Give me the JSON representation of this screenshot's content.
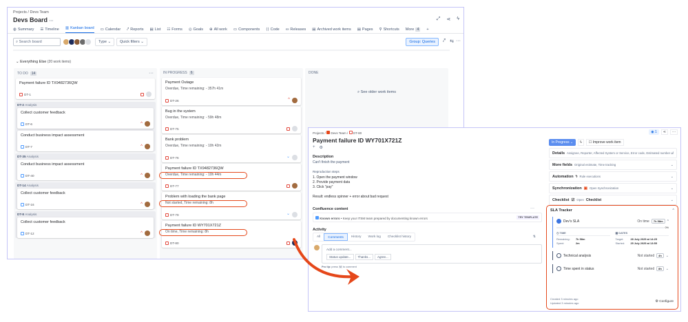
{
  "board": {
    "breadcrumb": [
      "Projects",
      "/",
      "Devs Team"
    ],
    "title": "Devs Board",
    "tabs": [
      "Summary",
      "Timeline",
      "Kanban board",
      "Calendar",
      "Reports",
      "List",
      "Forms",
      "Goals",
      "All work",
      "Components",
      "Code",
      "Releases",
      "Archived work items",
      "Pages",
      "Shortcuts"
    ],
    "active_tab": 2,
    "more_label": "More",
    "more_count": "4",
    "search_placeholder": "Search board",
    "type_label": "Type",
    "quick_filters_label": "Quick filters",
    "group_label": "Group: Queries",
    "swimlane": {
      "label": "Everything Else",
      "count": "(20 work items)"
    },
    "columns": {
      "todo": {
        "title": "TO DO",
        "count": "14"
      },
      "inprogress": {
        "title": "IN PROGRESS",
        "count": "6"
      },
      "done": {
        "title": "DONE",
        "see_older": "See older work items"
      }
    },
    "todo_items": [
      {
        "title": "Payment failure ID TX9482736QW",
        "key": "DT-1",
        "type": "bug",
        "assignee": "none"
      },
      {
        "group": "DT-2",
        "group_label": "Analysis",
        "items": [
          {
            "title": "Collect customer feedback",
            "key": "DT-6",
            "type": "subtask",
            "assignee": "user"
          },
          {
            "title": "Conduct business impact assessment",
            "key": "DT-7",
            "type": "subtask",
            "assignee": "user"
          }
        ]
      },
      {
        "group": "DT-35",
        "group_label": "Analysis",
        "items": [
          {
            "title": "Conduct business impact assessment",
            "key": "DT-40",
            "type": "subtask",
            "assignee": "user"
          }
        ]
      },
      {
        "group": "DT-14",
        "group_label": "Analysis",
        "items": [
          {
            "title": "Collect customer feedback",
            "key": "DT-16",
            "type": "subtask",
            "assignee": "user"
          }
        ]
      },
      {
        "group": "DT-8",
        "group_label": "Analysis",
        "items": [
          {
            "title": "Collect customer feedback",
            "key": "DT-12",
            "type": "subtask",
            "assignee": "user"
          }
        ]
      }
    ],
    "inprogress_items": [
      {
        "title": "Payment Outage",
        "status": "Overdue, Time remaining: - 357h 41m",
        "key": "DT-26",
        "priority": "high",
        "highlighted": false
      },
      {
        "title": "Bug in the system",
        "status": "Overdue, Time remaining: - 59h 48m",
        "key": "DT-75",
        "priority": "bug",
        "highlighted": false
      },
      {
        "title": "Bank problem",
        "status": "Overdue, Time remaining: - 10h 42m",
        "key": "DT-76",
        "priority": "low",
        "highlighted": false
      },
      {
        "title": "Payment failure ID TX9482736QW",
        "status": "Overdue, Time remaining: - 10h 44m",
        "key": "DT-77",
        "priority": "bug",
        "highlighted": true
      },
      {
        "title": "Problem with loading the bank page",
        "status": "Not started, Time remaining: 8h",
        "key": "DT-79",
        "priority": "low",
        "highlighted": true
      },
      {
        "title": "Payment failure ID WY701X721Z",
        "status": "On time, Time remaining: 8h",
        "key": "DT-80",
        "priority": "bug",
        "highlighted": true
      }
    ]
  },
  "detail": {
    "breadcrumb": [
      "Projects",
      "/",
      "Devs Team",
      "/",
      "DT-80"
    ],
    "title": "Payment failure ID WY701X721Z",
    "description_heading": "Description",
    "description": "Can't finish the payment",
    "repro_heading": "Reproduction steps",
    "steps": [
      "1. Open the payment window",
      "2. Provide payment data",
      "3. Click \"pay\""
    ],
    "result": "Result: endless spinner + error about bad request",
    "confluence": {
      "heading": "Confluence content",
      "item": "Known errors",
      "text": "• Keep your ITSM team prepared by documenting known errors",
      "button": "TRY TEMPLATE"
    },
    "activity": {
      "heading": "Activity",
      "tabs": [
        "All",
        "Comments",
        "History",
        "Work log",
        "Checklist history"
      ],
      "active_tab": 1,
      "comment_placeholder": "Add a comment...",
      "quick_replies": [
        "Status update...",
        "Thanks...",
        "Agree..."
      ],
      "pro_tip": "Pro tip:",
      "pro_tip_press": "press",
      "pro_tip_key": "M",
      "pro_tip_end": "to comment"
    },
    "watchers": "1",
    "status": "In Progress",
    "improve_label": "Improve work item",
    "sections": [
      {
        "title": "Details",
        "hint": "Assignee, Reporter, Affected System or Service, Error code, Estimated number of ..."
      },
      {
        "title": "More fields",
        "hint": "Original estimate, Time tracking"
      },
      {
        "title": "Automation",
        "hint": "Rule executions"
      },
      {
        "title": "Synchronization",
        "hint": "Open Synchronization"
      },
      {
        "title": "Checklist",
        "hint": "Open",
        "hint_bold": "Checklist"
      }
    ],
    "sla": {
      "title": "SLA Tracker",
      "items": [
        {
          "name": "Dev's SLA",
          "state": "On time",
          "badge": "7h 58m",
          "progress_label": "0%",
          "progress": 0
        },
        {
          "name": "Technical analysis",
          "state": "Not started",
          "badge": "4h"
        },
        {
          "name": "Time spent in status",
          "state": "Not started",
          "badge": "8h"
        }
      ],
      "time_heading": "TIME",
      "dates_heading": "DATES",
      "remaining_label": "Remaining:",
      "remaining": "7h 58m",
      "spent_label": "Spent:",
      "spent": "2m",
      "target_label": "Target:",
      "target": "28 July 2025 at 14:25",
      "started_label": "Started:",
      "started": "25 July 2025 at 13:55",
      "created": "Created 3 minutes ago",
      "updated": "Updated 3 minutes ago",
      "configure": "Configure"
    }
  },
  "colors": {
    "accent": "#0c66e4",
    "highlight": "#e5471a",
    "window_border": "#c4c4f7"
  }
}
